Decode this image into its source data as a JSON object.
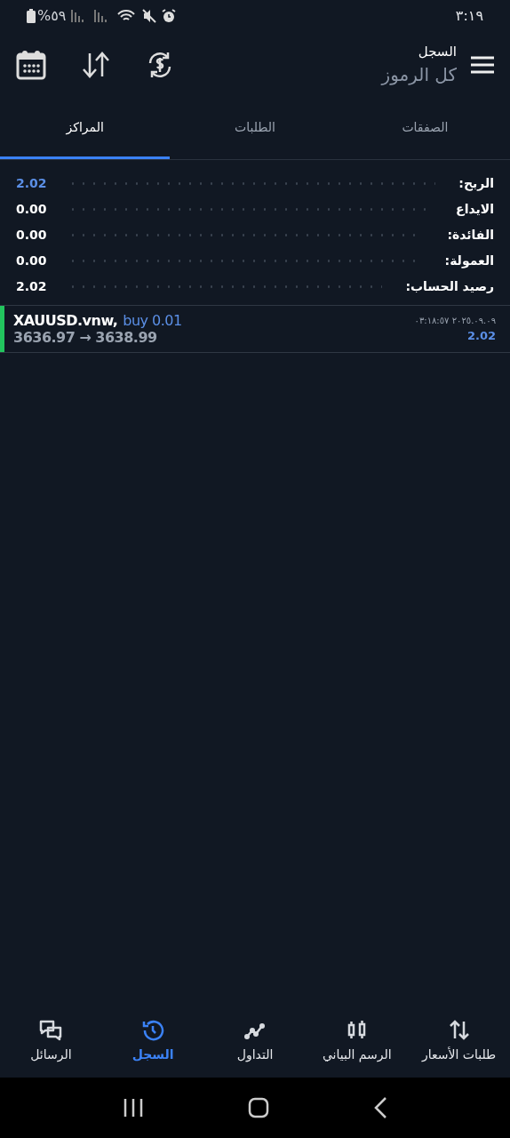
{
  "status_bar": {
    "time": "٣:١٩",
    "battery": "%٥٩"
  },
  "header": {
    "title": "السجل",
    "subtitle": "كل الرموز"
  },
  "tabs": [
    {
      "label": "الصفقات",
      "selected": false
    },
    {
      "label": "الطلبات",
      "selected": false
    },
    {
      "label": "المراكز",
      "selected": true
    }
  ],
  "summary": [
    {
      "label": "الربح:",
      "value": "2.02",
      "accent": true
    },
    {
      "label": "الايداع",
      "value": "0.00",
      "accent": false
    },
    {
      "label": "الفائدة:",
      "value": "0.00",
      "accent": false
    },
    {
      "label": "العمولة:",
      "value": "0.00",
      "accent": false
    },
    {
      "label": "رصيد الحساب:",
      "value": "2.02",
      "accent": false
    }
  ],
  "deals": [
    {
      "symbol": "XAUUSD.vnw,",
      "side": "buy 0.01",
      "open_price": "3636.97",
      "arrow": "→",
      "close_price": "3638.99",
      "time": "٢٠٢٥.٠٩.٠٩ ٠٣:١٨:٥٧",
      "profit": "2.02"
    }
  ],
  "bottom_nav": [
    {
      "label": "طلبات الأسعار",
      "kind": "quotes",
      "selected": false
    },
    {
      "label": "الرسم البياني",
      "kind": "chart",
      "selected": false
    },
    {
      "label": "التداول",
      "kind": "trade",
      "selected": false
    },
    {
      "label": "السجل",
      "kind": "history",
      "selected": true
    },
    {
      "label": "الرسائل",
      "kind": "messages",
      "selected": false
    }
  ]
}
